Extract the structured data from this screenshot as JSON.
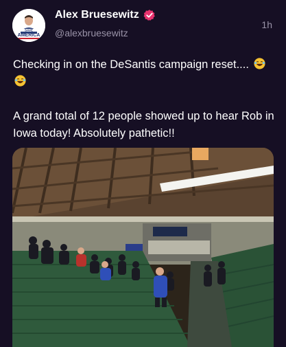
{
  "user": {
    "name": "Alex Bruesewitz",
    "handle": "@alexbruesewitz",
    "time": "1h",
    "avatar_text_top": "SAVE",
    "avatar_text_bottom": "AMERICA"
  },
  "post": {
    "line1": "Checking in on the DeSantis campaign reset....",
    "line2": "A grand total of 12 people showed up to hear Rob in Iowa today! Absolutely pathetic!!"
  },
  "colors": {
    "background": "#160f24",
    "verified_badge": "#e8336f",
    "secondary_text": "#9a93a8"
  },
  "icons": [
    "verified-badge-icon",
    "laughing-emoji-icon"
  ]
}
